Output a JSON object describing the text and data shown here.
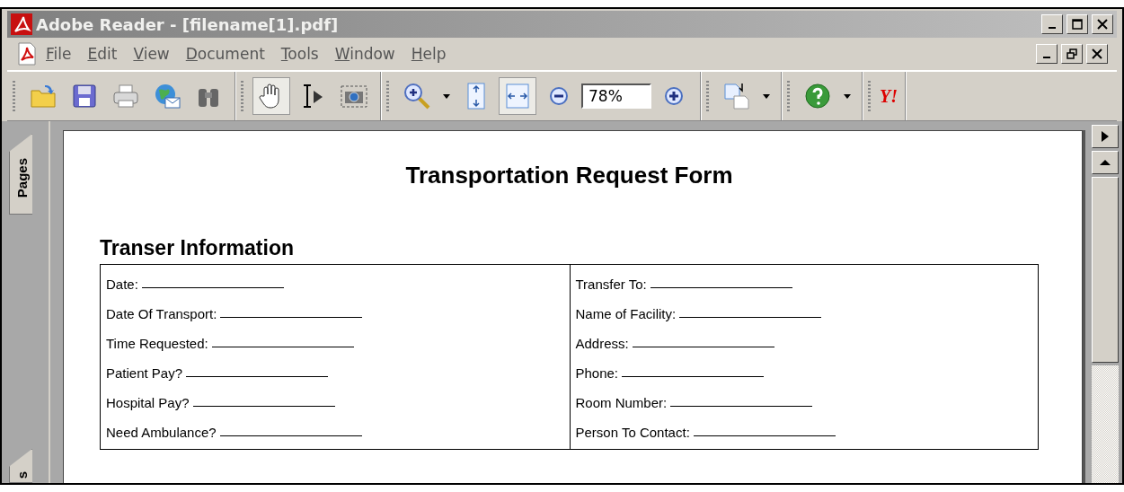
{
  "window": {
    "title": "Adobe Reader - [filename[1].pdf]"
  },
  "menu": [
    "File",
    "Edit",
    "View",
    "Document",
    "Tools",
    "Window",
    "Help"
  ],
  "toolbar": [
    [
      {
        "kind": "open",
        "selected": false
      },
      {
        "kind": "save",
        "selected": false
      },
      {
        "kind": "print",
        "selected": false
      },
      {
        "kind": "email",
        "selected": false
      },
      {
        "kind": "search",
        "selected": false
      }
    ],
    [
      {
        "kind": "hand",
        "selected": true
      },
      {
        "kind": "select",
        "selected": false
      },
      {
        "kind": "snapshot",
        "selected": false
      }
    ],
    [
      {
        "kind": "zoomin",
        "selected": false
      },
      {
        "kind": "fitpage",
        "selected": false
      },
      {
        "kind": "fitwidth",
        "selected": true
      },
      {
        "kind": "zoomout",
        "selected": false
      },
      {
        "kind": "zoomfield",
        "value": "78%"
      },
      {
        "kind": "plus",
        "selected": false
      }
    ],
    [
      {
        "kind": "pages",
        "selected": false
      }
    ],
    [
      {
        "kind": "help",
        "selected": false
      }
    ],
    [
      {
        "kind": "yahoo",
        "label": "Y!"
      }
    ]
  ],
  "side_tabs": [
    "Pages",
    "s"
  ],
  "document": {
    "title": "Transportation Request Form",
    "section": "Transer Information",
    "left_fields": [
      "Date:",
      "Date Of Transport:",
      "Time Requested:",
      "Patient Pay?",
      "Hospital Pay?",
      "Need Ambulance?"
    ],
    "right_fields": [
      "Transfer To:",
      "Name of Facility:",
      "Address:",
      "Phone:",
      "Room Number:",
      "Person To Contact:"
    ]
  }
}
